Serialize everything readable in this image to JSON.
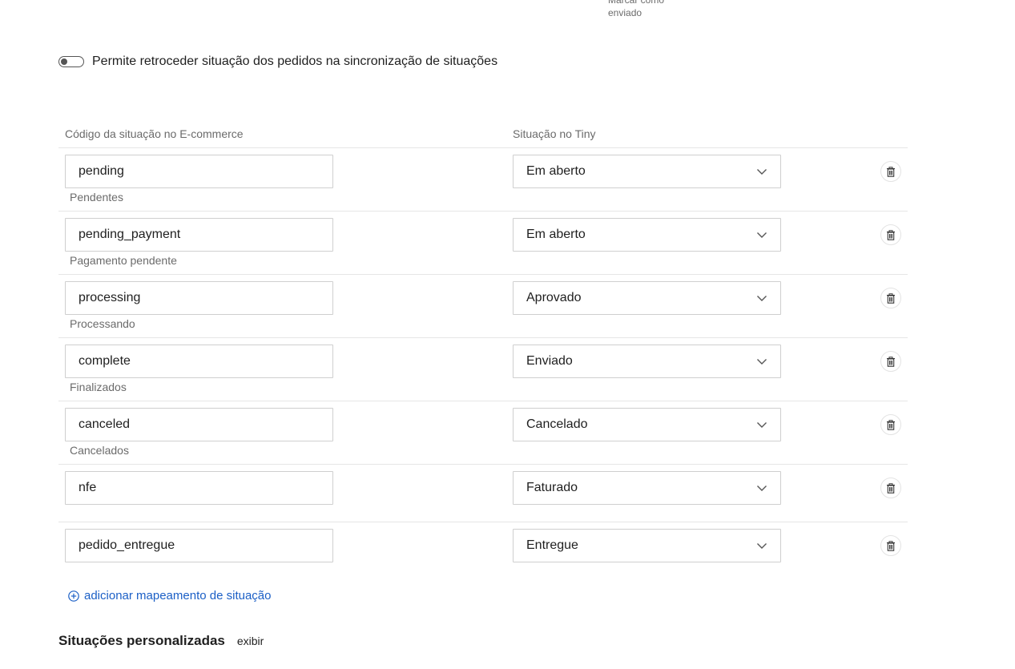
{
  "top_note": {
    "line1": "Marcar como",
    "line2": "enviado"
  },
  "retro_toggle": {
    "label": "Permite retroceder situação dos pedidos na sincronização de situações",
    "checked": false
  },
  "table": {
    "col_code": "Código da situação no E-commerce",
    "col_status": "Situação no Tiny",
    "rows": [
      {
        "code": "pending",
        "desc": "Pendentes",
        "status": "Em aberto"
      },
      {
        "code": "pending_payment",
        "desc": "Pagamento pendente",
        "status": "Em aberto"
      },
      {
        "code": "processing",
        "desc": "Processando",
        "status": "Aprovado"
      },
      {
        "code": "complete",
        "desc": "Finalizados",
        "status": "Enviado"
      },
      {
        "code": "canceled",
        "desc": "Cancelados",
        "status": "Cancelado"
      },
      {
        "code": "nfe",
        "desc": "",
        "status": "Faturado"
      },
      {
        "code": "pedido_entregue",
        "desc": "",
        "status": "Entregue"
      }
    ]
  },
  "add_mapping": {
    "label": "adicionar mapeamento de situação",
    "icon": "plus-circle-icon"
  },
  "custom_statuses": {
    "title": "Situações personalizadas",
    "toggle_label": "exibir"
  },
  "colors": {
    "link": "#1b5fc6",
    "border": "#cfcfcf",
    "muted_text": "#6b6b6b"
  }
}
